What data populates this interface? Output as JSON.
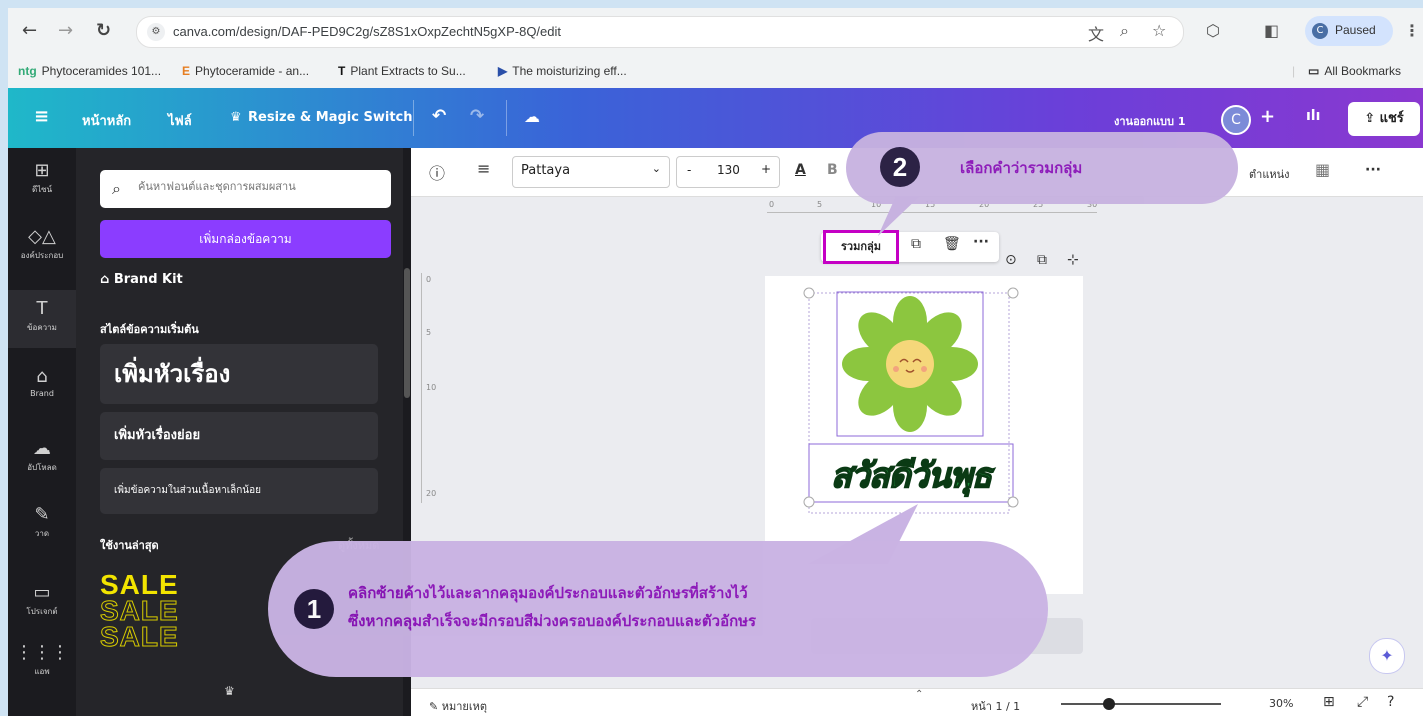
{
  "browser": {
    "url": "canva.com/design/DAF-PED9C2g/sZ8S1xOxpZechtN5gXP-8Q/edit",
    "profile_initial": "C",
    "profile_status": "Paused",
    "bookmarks": [
      {
        "icon": "ntg",
        "label": "Phytoceramides 101..."
      },
      {
        "icon": "E",
        "label": "Phytoceramide - an..."
      },
      {
        "icon": "T",
        "label": "Plant Extracts to Su..."
      },
      {
        "icon": "▶",
        "label": "The moisturizing eff..."
      }
    ],
    "all_bookmarks": "All Bookmarks"
  },
  "header": {
    "home": "หน้าหลัก",
    "file": "ไฟล์",
    "resize": "Resize & Magic Switch",
    "design_title": "งานออกแบบ 1",
    "avatar_initial": "C",
    "share": "แชร์"
  },
  "rail": [
    {
      "icon": "layout-icon",
      "label": "ดีไซน์"
    },
    {
      "icon": "elements-icon",
      "label": "องค์ประกอบ"
    },
    {
      "icon": "text-icon",
      "label": "ข้อความ"
    },
    {
      "icon": "brand-icon",
      "label": "Brand"
    },
    {
      "icon": "upload-icon",
      "label": "อัปโหลด"
    },
    {
      "icon": "draw-icon",
      "label": "วาด"
    },
    {
      "icon": "projects-icon",
      "label": "โปรเจกต์"
    },
    {
      "icon": "apps-icon",
      "label": "แอพ"
    }
  ],
  "panel": {
    "search_placeholder": "ค้นหาฟอนต์และชุดการผสมผสาน",
    "add_textbox": "เพิ่มกล่องข้อความ",
    "brand_kit": "Brand Kit",
    "default_styles": "สไตล์ข้อความเริ่มต้น",
    "heading": "เพิ่มหัวเรื่อง",
    "subheading": "เพิ่มหัวเรื่องย่อย",
    "body": "เพิ่มข้อความในส่วนเนื้อหาเล็กน้อย",
    "recent": "ใช้งานล่าสุด",
    "see_all": "ดูทั้งหมด",
    "sale": "SALE"
  },
  "toolbar": {
    "font": "Pattaya",
    "size": "130",
    "minus": "-",
    "plus": "+",
    "position": "ตำแหน่ง",
    "more": "···"
  },
  "ruler": [
    "0",
    "5",
    "10",
    "15",
    "20",
    "25",
    "30"
  ],
  "context": {
    "group": "รวมกลุ่ม",
    "more": "···"
  },
  "canvas": {
    "text": "สวัสดีวันพุธ"
  },
  "bottom": {
    "notes": "หมายเหตุ",
    "page": "หน้า 1 / 1",
    "zoom": "30%",
    "zoom_level": 0.3
  },
  "callouts": {
    "step2_num": "2",
    "step2_text": "เลือกคำว่ารวมกลุ่ม",
    "step1_num": "1",
    "step1_line1": "คลิกซ้ายค้างไว้และลากคลุมองค์ประกอบและตัวอักษรที่สร้างไว้",
    "step1_line2": "ซึ่งหากคลุมสำเร็จจะมีกรอบสีม่วงครอบองค์ประกอบและตัวอักษร"
  },
  "colors": {
    "accent_purple": "#8b3dff",
    "callout_text": "#8a14b8",
    "group_highlight": "#c400c4",
    "flower_petal": "#8cc63f",
    "flower_center": "#f5d77a",
    "word_fill": "#1e8c3a"
  }
}
